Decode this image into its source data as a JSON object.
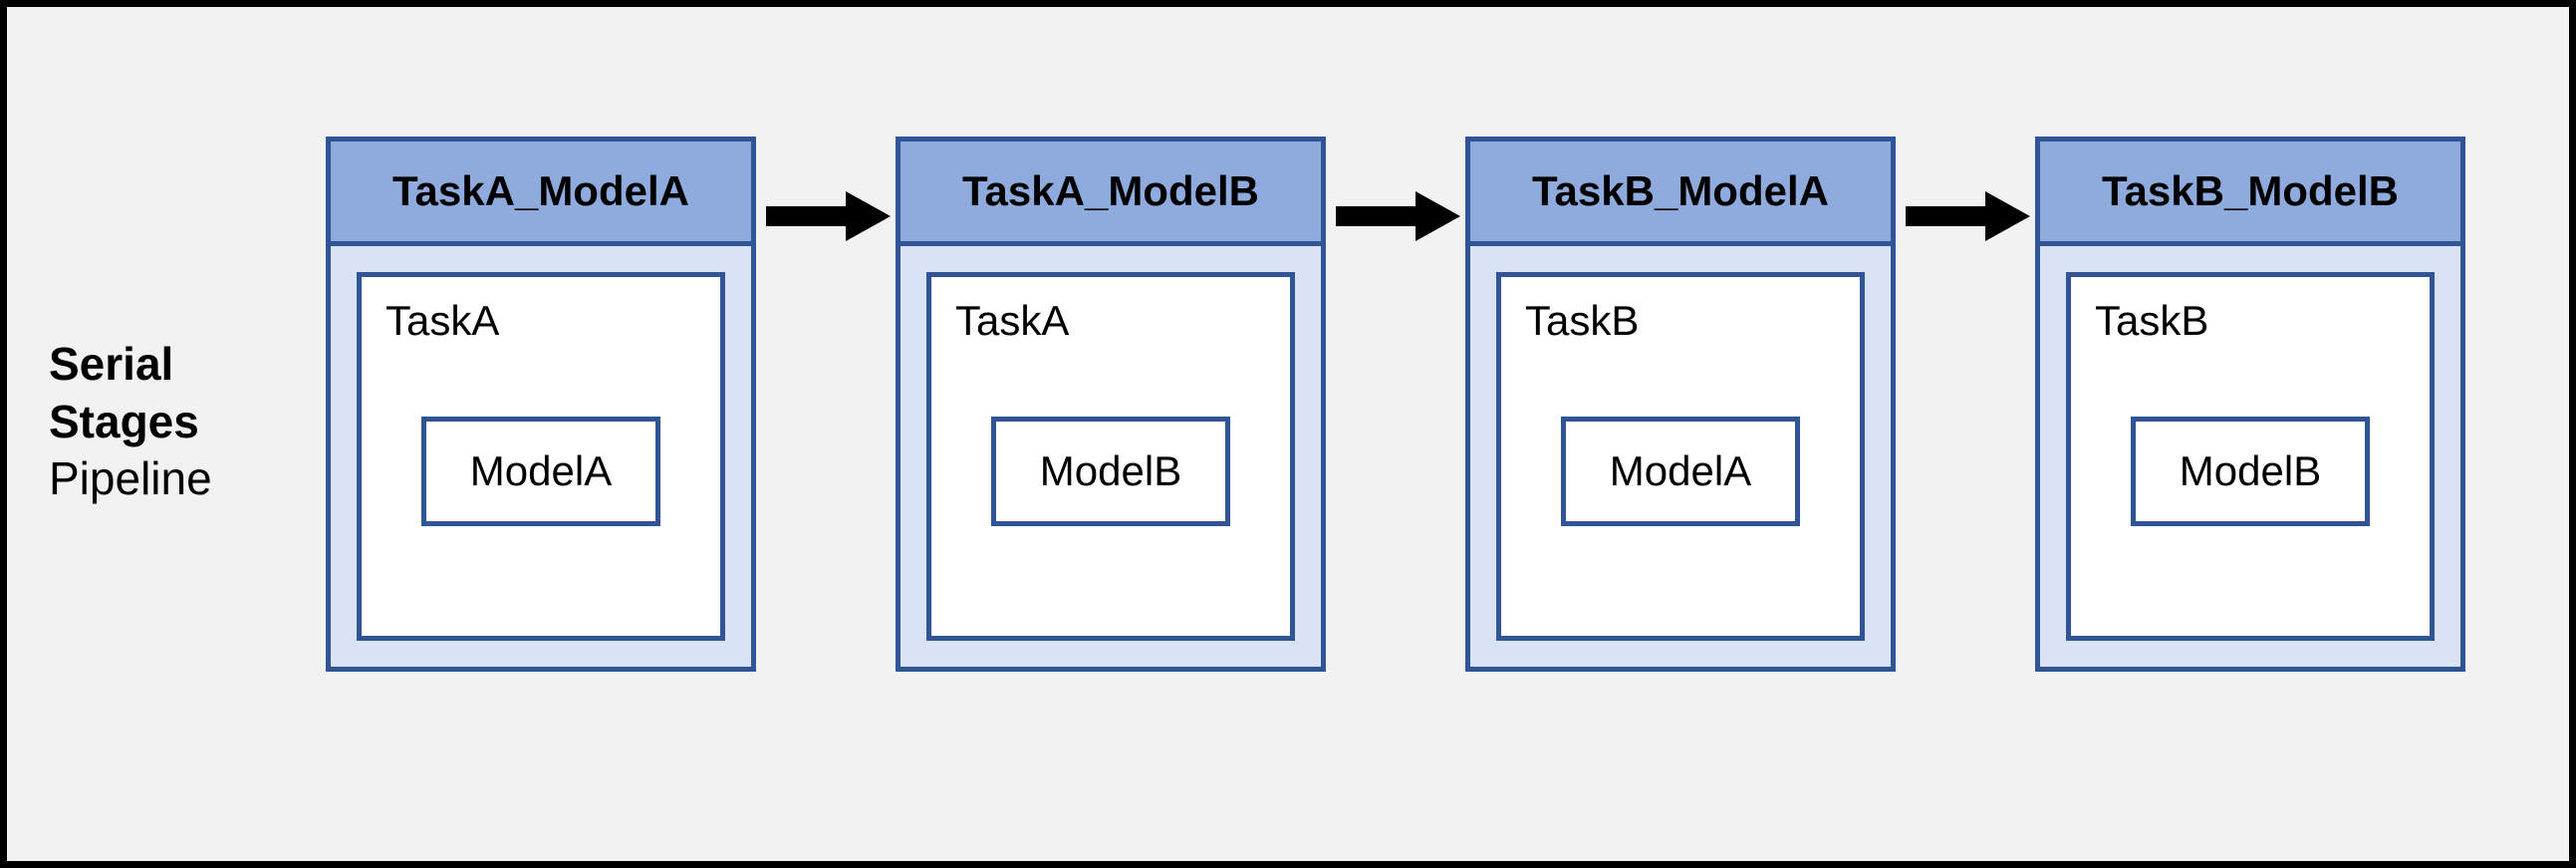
{
  "label": {
    "line1": "Serial",
    "line2": "Stages",
    "line3": "Pipeline"
  },
  "stages": [
    {
      "title": "TaskA_ModelA",
      "task": "TaskA",
      "model": "ModelA"
    },
    {
      "title": "TaskA_ModelB",
      "task": "TaskA",
      "model": "ModelB"
    },
    {
      "title": "TaskB_ModelA",
      "task": "TaskB",
      "model": "ModelA"
    },
    {
      "title": "TaskB_ModelB",
      "task": "TaskB",
      "model": "ModelB"
    }
  ],
  "colors": {
    "border": "#2f5597",
    "header_fill": "#8faadc",
    "body_fill": "#dae3f3",
    "canvas_fill": "#f2f2f2",
    "arrow": "#000000"
  }
}
